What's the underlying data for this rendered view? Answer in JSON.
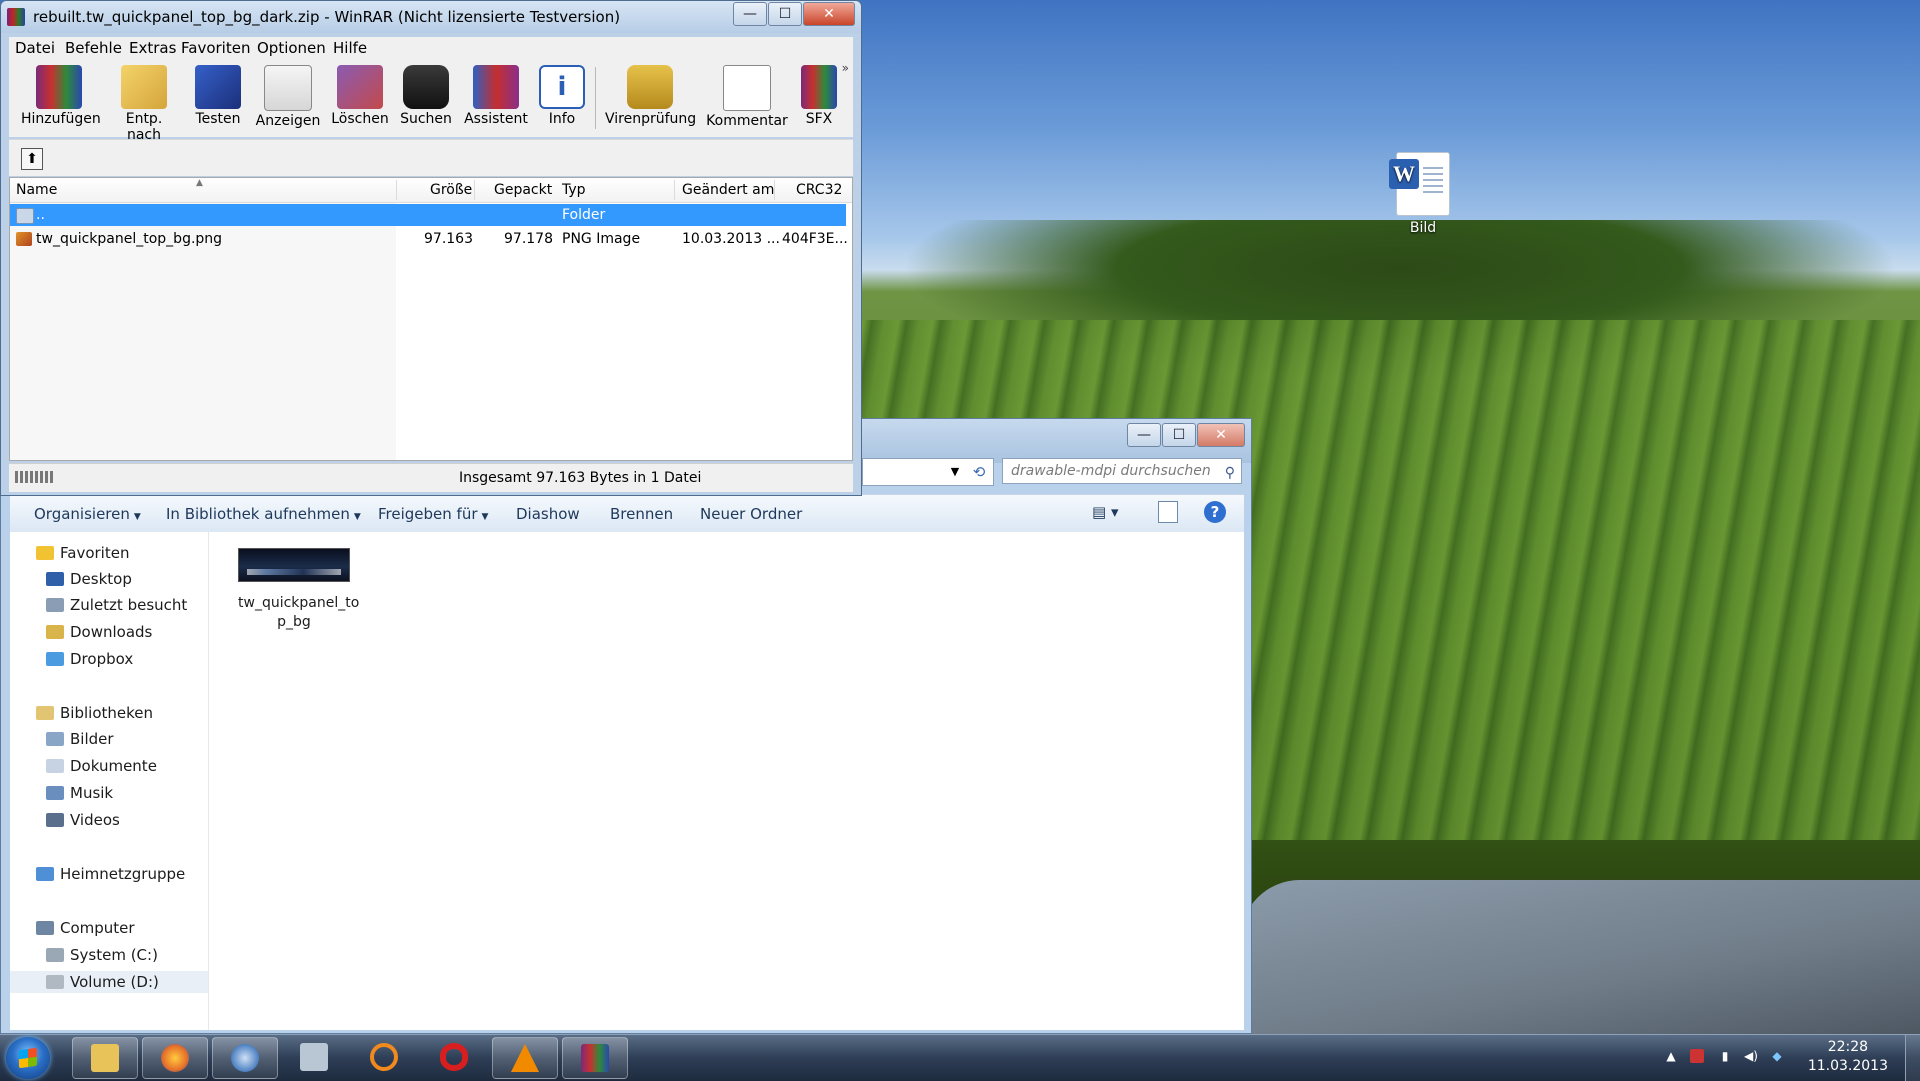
{
  "desktop": {
    "icons": [
      {
        "label": "Bild",
        "glyph": "W"
      }
    ]
  },
  "winrar": {
    "title": "rebuilt.tw_quickpanel_top_bg_dark.zip - WinRAR (Nicht lizensierte Testversion)",
    "window_controls": {
      "minimize": "—",
      "maximize": "☐",
      "close": "✕"
    },
    "menu": [
      "Datei",
      "Befehle",
      "Extras",
      "Favoriten",
      "Optionen",
      "Hilfe"
    ],
    "toolbar": [
      {
        "label": "Hinzufügen",
        "icon": "add-archive-icon"
      },
      {
        "label": "Entp. nach",
        "icon": "extract-to-icon"
      },
      {
        "label": "Testen",
        "icon": "test-icon"
      },
      {
        "label": "Anzeigen",
        "icon": "view-icon"
      },
      {
        "label": "Löschen",
        "icon": "delete-icon"
      },
      {
        "label": "Suchen",
        "icon": "find-icon"
      },
      {
        "label": "Assistent",
        "icon": "wizard-icon"
      },
      {
        "label": "Info",
        "icon": "info-icon"
      },
      {
        "label": "Virenprüfung",
        "icon": "virus-scan-icon"
      },
      {
        "label": "Kommentar",
        "icon": "comment-icon"
      },
      {
        "label": "SFX",
        "icon": "sfx-icon"
      }
    ],
    "toolbar_more": "»",
    "up_button": "⬆",
    "columns": [
      "Name",
      "Größe",
      "Gepackt",
      "Typ",
      "Geändert am",
      "CRC32"
    ],
    "rows": [
      {
        "name": "..",
        "size": "",
        "packed": "",
        "type": "Folder",
        "modified": "",
        "crc": "",
        "selected": true
      },
      {
        "name": "tw_quickpanel_top_bg.png",
        "size": "97.163",
        "packed": "97.178",
        "type": "PNG Image",
        "modified": "10.03.2013 ...",
        "crc": "404F3E...",
        "selected": false
      }
    ],
    "status": "Insgesamt 97.163 Bytes in 1 Datei"
  },
  "explorer": {
    "window_controls": {
      "minimize": "—",
      "maximize": "☐",
      "close": "✕"
    },
    "search_placeholder": "drawable-mdpi durchsuchen",
    "commands": [
      {
        "label": "Organisieren",
        "dropdown": true
      },
      {
        "label": "In Bibliothek aufnehmen",
        "dropdown": true
      },
      {
        "label": "Freigeben für",
        "dropdown": true
      },
      {
        "label": "Diashow",
        "dropdown": false
      },
      {
        "label": "Brennen",
        "dropdown": false
      },
      {
        "label": "Neuer Ordner",
        "dropdown": false
      }
    ],
    "nav": {
      "favorites": "Favoriten",
      "favorites_items": [
        "Desktop",
        "Zuletzt besucht",
        "Downloads",
        "Dropbox"
      ],
      "libraries": "Bibliotheken",
      "libraries_items": [
        "Bilder",
        "Dokumente",
        "Musik",
        "Videos"
      ],
      "homegroup": "Heimnetzgruppe",
      "computer": "Computer",
      "computer_items": [
        "System (C:)",
        "Volume (D:)"
      ]
    },
    "files": [
      {
        "label": "tw_quickpanel_to\np_bg"
      }
    ]
  },
  "taskbar": {
    "apps": [
      {
        "name": "explorer",
        "icon": "folder-icon",
        "color": "#e8c35a"
      },
      {
        "name": "firefox",
        "icon": "firefox-icon",
        "color": "#e8702a"
      },
      {
        "name": "thunderbird",
        "icon": "thunderbird-icon",
        "color": "#4a7fc1"
      },
      {
        "name": "calculator",
        "icon": "calculator-icon",
        "color": "#b9c6d3"
      },
      {
        "name": "link",
        "icon": "chain-icon",
        "color": "#f08a1f"
      },
      {
        "name": "opera",
        "icon": "opera-icon",
        "color": "#d81f1f"
      },
      {
        "name": "vlc",
        "icon": "vlc-icon",
        "color": "#f28a00"
      },
      {
        "name": "winrar",
        "icon": "winrar-icon",
        "color": "#7a2a7a"
      }
    ],
    "time": "22:28",
    "date": "11.03.2013"
  }
}
